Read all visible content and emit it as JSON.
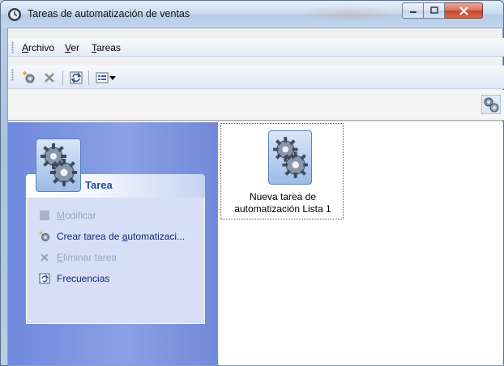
{
  "window": {
    "title": "Tareas de automatización de ventas",
    "app_icon": "clock-gear-icon",
    "buttons": [
      "minimize-icon",
      "maximize-icon",
      "close-icon"
    ]
  },
  "menu": {
    "items": [
      {
        "label_under": "A",
        "label_rest": "rchivo"
      },
      {
        "label_under": "V",
        "label_rest": "er"
      },
      {
        "label_under": "T",
        "label_rest": "areas"
      }
    ]
  },
  "toolbar": {
    "icons": [
      "new-task-icon",
      "delete-icon",
      "refresh-icon",
      "view-icon",
      "dropdown-arrow-icon"
    ]
  },
  "task_panel": {
    "title": "Tarea",
    "items": [
      {
        "icon": "edit-icon",
        "label_pre": "",
        "label_under": "M",
        "label_post": "odificar",
        "enabled": false
      },
      {
        "icon": "new-task-icon",
        "label_pre": "Crear tarea de ",
        "label_under": "a",
        "label_post": "utomatizaci...",
        "enabled": true
      },
      {
        "icon": "delete-icon",
        "label_pre": "",
        "label_under": "E",
        "label_post": "liminar tarea",
        "enabled": false
      },
      {
        "icon": "frequency-icon",
        "label_pre": "Frecuencias",
        "label_under": "",
        "label_post": "",
        "enabled": true
      }
    ]
  },
  "content": {
    "items": [
      {
        "line1": "Nueva tarea de",
        "line2": "automatización Lista 1",
        "icon": "gears-icon"
      }
    ]
  },
  "colors": {
    "task_text_enabled": "#102c78",
    "task_text_disabled": "#9aa5c0",
    "task_title": "#214aa3",
    "left_pane": "#7a92e0"
  }
}
